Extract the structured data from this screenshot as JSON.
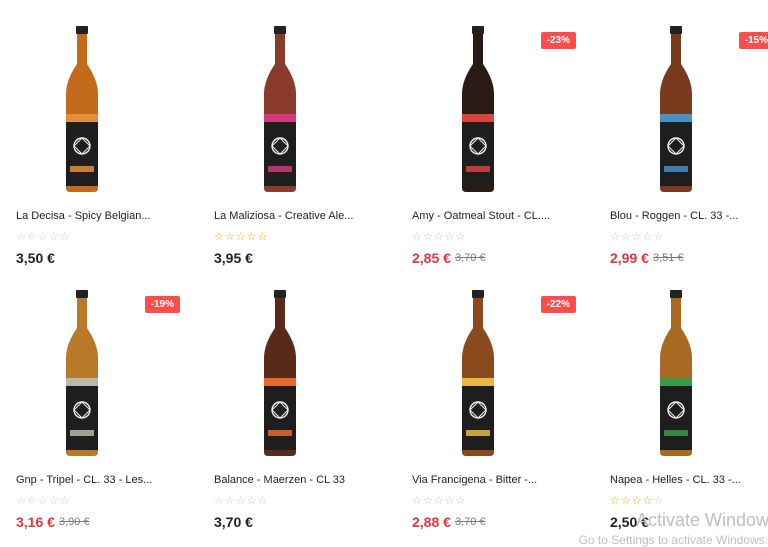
{
  "products": [
    {
      "name": "La Decisa - Spicy Belgian...",
      "price": "3,50 €",
      "old_price": "",
      "discount": "",
      "rating": 0,
      "label_color": "#e3903a",
      "glass": "#c46a1c"
    },
    {
      "name": "La Maliziosa - Creative Ale...",
      "price": "3,95 €",
      "old_price": "",
      "discount": "",
      "rating": 5,
      "label_color": "#d23a7a",
      "glass": "#8a3a2a"
    },
    {
      "name": "Amy - Oatmeal Stout - CL....",
      "price": "2,85 €",
      "old_price": "3,70 €",
      "discount": "-23%",
      "rating": 0,
      "label_color": "#d8453c",
      "glass": "#2a1a16"
    },
    {
      "name": "Blou - Roggen - CL. 33 -...",
      "price": "2,99 €",
      "old_price": "3,51 €",
      "discount": "-15%",
      "rating": 0,
      "label_color": "#4a90c8",
      "glass": "#7a3a1e"
    },
    {
      "name": "Gnp - Tripel - CL. 33 - Les...",
      "price": "3,16 €",
      "old_price": "3,90 €",
      "discount": "-19%",
      "rating": 0,
      "label_color": "#b8b8a8",
      "glass": "#b87a2a"
    },
    {
      "name": "Balance - Maerzen - CL 33",
      "price": "3,70 €",
      "old_price": "",
      "discount": "",
      "rating": 0,
      "label_color": "#e36a2a",
      "glass": "#5a2a18"
    },
    {
      "name": "Via Francigena - Bitter -...",
      "price": "2,88 €",
      "old_price": "3,70 €",
      "discount": "-22%",
      "rating": 0,
      "label_color": "#e8b840",
      "glass": "#8a4a1e"
    },
    {
      "name": "Napea - Helles - CL. 33 -...",
      "price": "2,50 €",
      "old_price": "",
      "discount": "",
      "rating": 4,
      "label_color": "#3a9a4a",
      "glass": "#a86a22"
    }
  ],
  "watermark": {
    "line1": "Activate Windows",
    "line2": "Go to Settings to activate Windows."
  },
  "colors": {
    "sale": "#e5343a",
    "badge": "#ff4c4c",
    "star_on": "#f0a500",
    "star_off": "#c8c8c8"
  }
}
